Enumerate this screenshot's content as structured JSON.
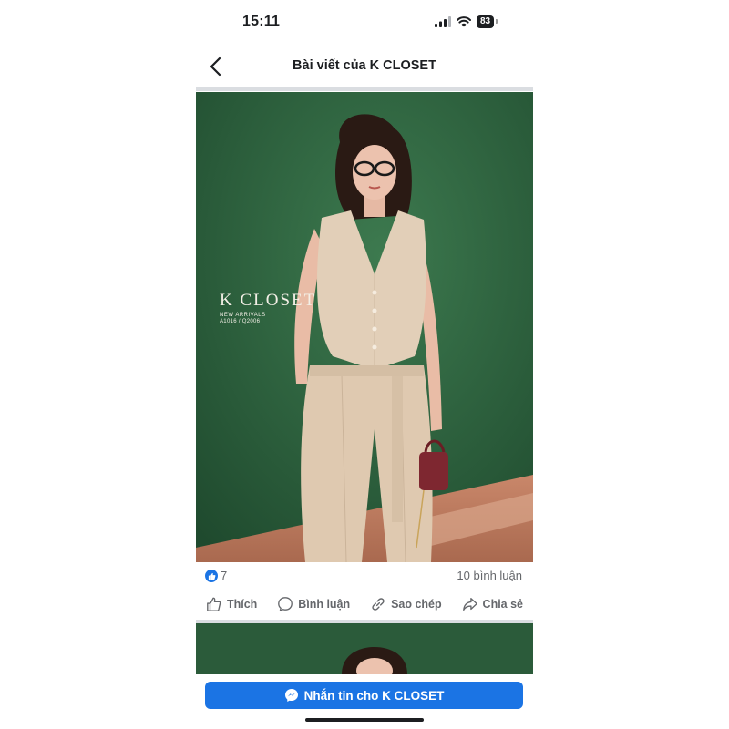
{
  "status_bar": {
    "time": "15:11",
    "battery": "83",
    "icons": [
      "signal-icon",
      "wifi-icon",
      "battery-icon"
    ]
  },
  "header": {
    "title": "Bài viết của K CLOSET",
    "back_icon": "chevron-left-icon"
  },
  "post": {
    "photo_overlay": {
      "brand": "K CLOSET",
      "subtitle": "NEW ARRIVALS",
      "codes": "A1016  / Q2006"
    },
    "reactions": {
      "count": "7",
      "icon": "like-reaction-icon"
    },
    "comments": "10 bình luận",
    "actions": [
      {
        "label": "Thích",
        "icon": "thumbs-up-icon"
      },
      {
        "label": "Bình luận",
        "icon": "comment-icon"
      },
      {
        "label": "Sao chép",
        "icon": "link-icon"
      },
      {
        "label": "Chia sẻ",
        "icon": "share-icon"
      }
    ]
  },
  "cta": {
    "label": "Nhắn tin cho K CLOSET",
    "icon": "messenger-icon"
  },
  "colors": {
    "accent": "#1b74e4",
    "background_green": "#2a5a39",
    "text_secondary": "#65676b"
  }
}
